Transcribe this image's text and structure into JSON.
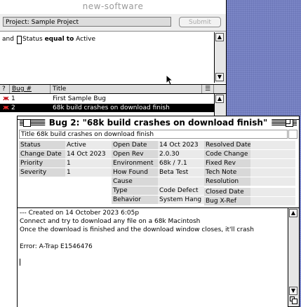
{
  "app_title": "new-software",
  "project": {
    "field": "Project: Sample Project",
    "submit_label": "Submit"
  },
  "query": {
    "conjunction": "and",
    "field": "Status",
    "operator": "equal to",
    "value": "Active"
  },
  "list": {
    "headers": {
      "flag": "?",
      "bug": "Bug #",
      "title": "Title"
    },
    "rows": [
      {
        "bug": "1",
        "title": "First Sample Bug",
        "selected": false
      },
      {
        "bug": "2",
        "title": "68k build crashes on download finish",
        "selected": true
      }
    ]
  },
  "bug_window": {
    "title": "Bug 2: \"68k build crashes on download finish\"",
    "title_field": "Title  68k build crashes on download finish",
    "col1": [
      {
        "label": "Status",
        "value": "Active"
      },
      {
        "label": "Change Date",
        "value": "14 Oct 2023"
      },
      {
        "label": "Priority",
        "value": "1"
      },
      {
        "label": "Severity",
        "value": "1"
      }
    ],
    "col2": [
      {
        "label": "Open Date",
        "value": "14 Oct 2023"
      },
      {
        "label": "Open Rev",
        "value": "2.0.30"
      },
      {
        "label": "Environment",
        "value": "68k / 7.1"
      },
      {
        "label": "How Found",
        "value": "Beta Test"
      },
      {
        "label": "Cause",
        "value": ""
      },
      {
        "label": "Type",
        "value": "Code Defect"
      },
      {
        "label": "Behavior",
        "value": "System Hang"
      }
    ],
    "col3": [
      {
        "label": "Resolved Date"
      },
      {
        "label": "Code Change"
      },
      {
        "label": "Fixed Rev"
      },
      {
        "label": "Tech Note"
      },
      {
        "label": "Resolution"
      },
      {
        "label": "Closed Date"
      },
      {
        "label": "Bug X-Ref"
      }
    ],
    "notes": [
      "---              Created on 14 October 2023 6:05p",
      "Connect and try to download any file on a 68k Macintosh",
      "Once the download is finished and the download window closes, it'll crash",
      "",
      "Error: A-Trap E1546476"
    ]
  }
}
